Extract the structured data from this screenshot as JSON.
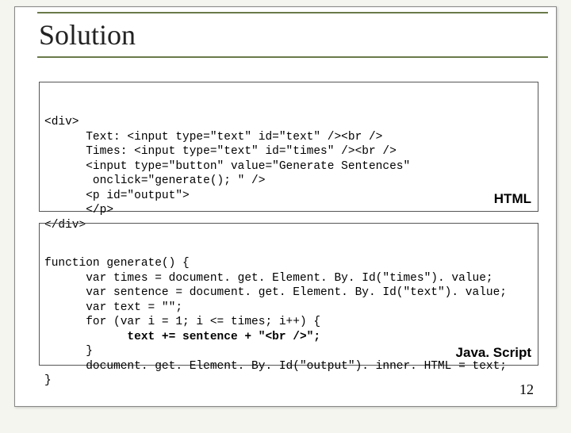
{
  "title": "Solution",
  "page_number": "12",
  "box1": {
    "label": "HTML",
    "lines": [
      "<div>",
      "      Text: <input type=\"text\" id=\"text\" /><br />",
      "      Times: <input type=\"text\" id=\"times\" /><br />",
      "      <input type=\"button\" value=\"Generate Sentences\"",
      "       onclick=\"generate(); \" />",
      "      <p id=\"output\">",
      "      </p>",
      "</div>"
    ]
  },
  "box2": {
    "label": "Java. Script",
    "lines": [
      "function generate() {",
      "      var times = document. get. Element. By. Id(\"times\"). value;",
      "      var sentence = document. get. Element. By. Id(\"text\"). value;",
      "      var text = \"\";",
      "      for (var i = 1; i <= times; i++) {",
      "            text += sentence + \"<br />\";",
      "      }",
      "      document. get. Element. By. Id(\"output\"). inner. HTML = text;",
      "}"
    ],
    "bold_line_index": 5
  }
}
